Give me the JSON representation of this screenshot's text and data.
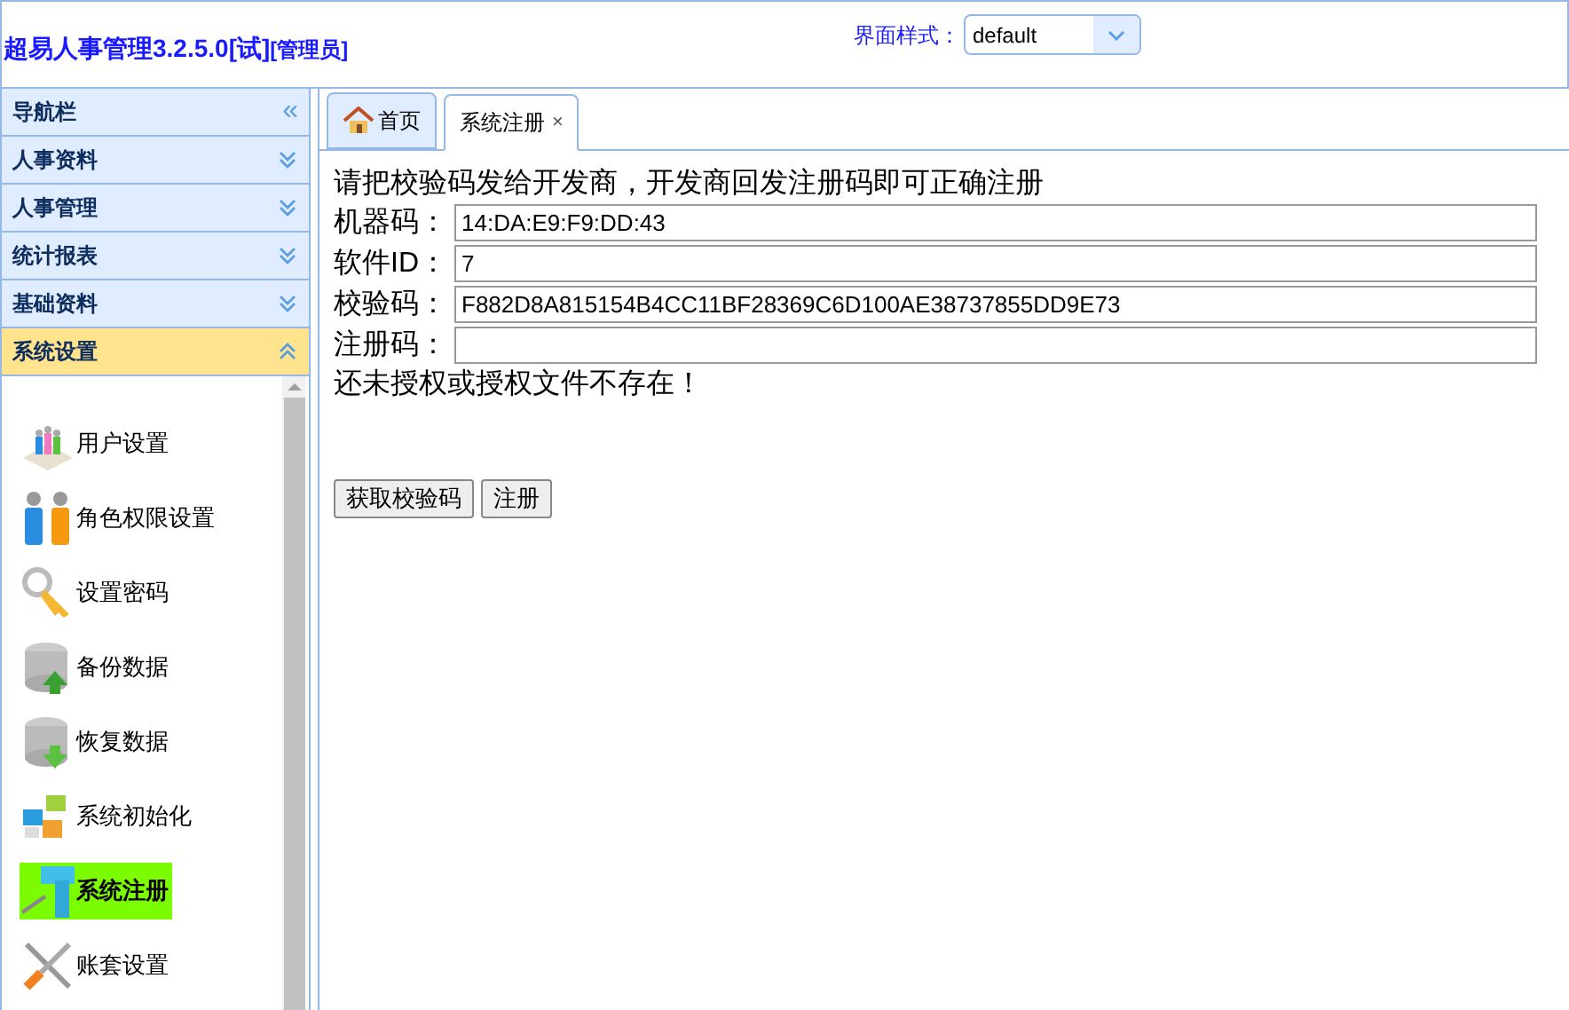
{
  "header": {
    "title": "超易人事管理3.2.5.0[试]",
    "role": "[管理员]",
    "style_label": "界面样式：",
    "style_value": "default"
  },
  "sidebar": {
    "title": "导航栏",
    "collapse": "«",
    "sections": [
      {
        "label": "人事资料",
        "expanded": false
      },
      {
        "label": "人事管理",
        "expanded": false
      },
      {
        "label": "统计报表",
        "expanded": false
      },
      {
        "label": "基础资料",
        "expanded": false
      },
      {
        "label": "系统设置",
        "expanded": true
      }
    ],
    "items": [
      {
        "label": "用户设置",
        "selected": false
      },
      {
        "label": "角色权限设置",
        "selected": false
      },
      {
        "label": "设置密码",
        "selected": false
      },
      {
        "label": "备份数据",
        "selected": false
      },
      {
        "label": "恢复数据",
        "selected": false
      },
      {
        "label": "系统初始化",
        "selected": false
      },
      {
        "label": "系统注册",
        "selected": true
      },
      {
        "label": "账套设置",
        "selected": false
      }
    ]
  },
  "tabs": [
    {
      "label": "首页",
      "selected": false,
      "kind": "home"
    },
    {
      "label": "系统注册",
      "selected": true,
      "kind": "closable",
      "close": "×"
    }
  ],
  "form": {
    "intro": "请把校验码发给开发商，开发商回发注册码即可正确注册",
    "fields": [
      {
        "label": "机器码：",
        "value": "14:DA:E9:F9:DD:43"
      },
      {
        "label": "软件ID：",
        "value": "7"
      },
      {
        "label": "校验码：",
        "value": "F882D8A815154B4CC11BF28369C6D100AE38737855DD9E73"
      },
      {
        "label": "注册码："
      }
    ],
    "status": "还未授权或授权文件不存在！",
    "buttons": [
      "获取校验码",
      "注册"
    ]
  }
}
